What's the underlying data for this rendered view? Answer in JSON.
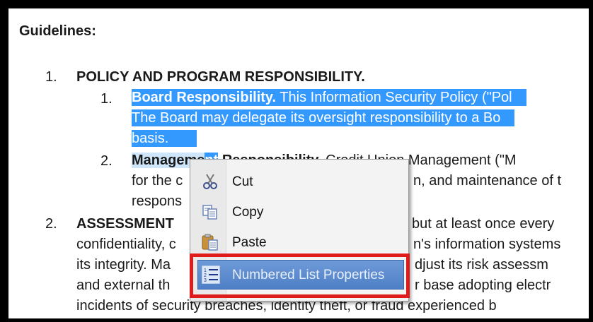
{
  "doc": {
    "heading": "Guidelines:",
    "item1": {
      "num": "1.",
      "title": "POLICY AND PROGRAM RESPONSIBILITY."
    },
    "sub1": {
      "num": "1.",
      "bold": "Board Responsibility.",
      "rest": " This Information Security Policy (\"Pol",
      "line2": "The Board may delegate its oversight responsibility to a Bo",
      "line3": "basis."
    },
    "sub2": {
      "num": "2.",
      "bold_a": "Manageme",
      "bold_b": "nt",
      "bold_c": " Responsibility.",
      "rest": " Credit Union Management (\"M",
      "line2a": "for the c",
      "line2b": "n, and maintenance of t",
      "line3": "respons"
    },
    "item2": {
      "num": "2.",
      "title": "ASSESSMENT",
      "rest1": "but at least once every",
      "line2a": "confidentiality, c",
      "line2b": "n's information systems",
      "line3a": "its integrity. Ma",
      "line3b": "djust its risk assessm",
      "line4a": "and external th",
      "line4b": "r base adopting electr",
      "line5": "incidents of security breaches, identity theft, or fraud experienced b"
    }
  },
  "context_menu": {
    "items": [
      {
        "label": "Cut",
        "icon": "scissors-icon"
      },
      {
        "label": "Copy",
        "icon": "copy-icon"
      },
      {
        "label": "Paste",
        "icon": "paste-icon"
      },
      {
        "label": "Numbered List Properties",
        "icon": "numbered-list-icon"
      }
    ]
  },
  "colors": {
    "selection": "#3399ff",
    "highlight_box": "#e01b1b",
    "menu_hover": "#5a88cc"
  }
}
